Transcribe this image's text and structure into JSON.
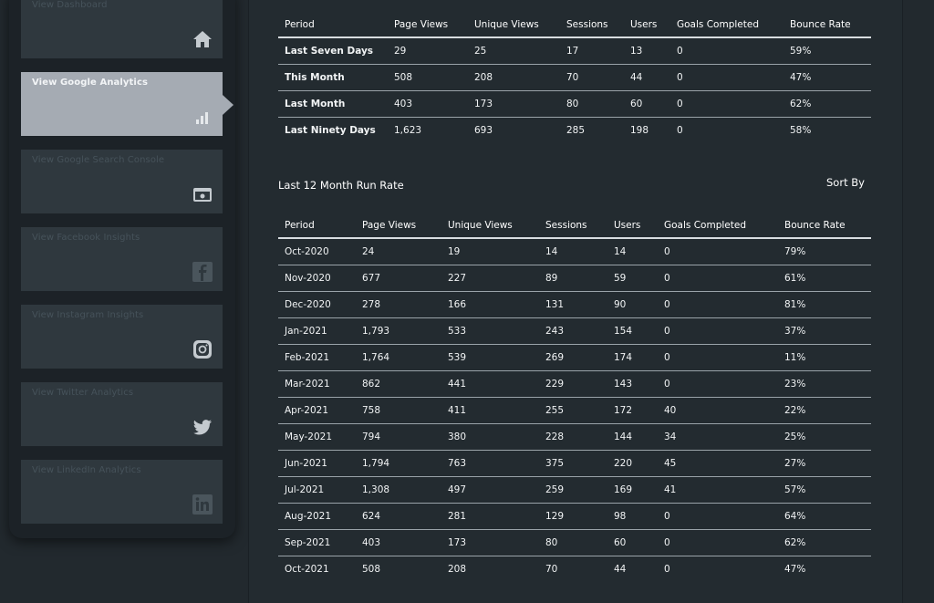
{
  "sidebar": {
    "items": [
      {
        "label": "View Dashboard",
        "icon": "home-icon",
        "active": false
      },
      {
        "label": "View Google Analytics",
        "icon": "analytics-icon",
        "active": true
      },
      {
        "label": "View Google Search Console",
        "icon": "search-console-icon",
        "active": false
      },
      {
        "label": "View Facebook Insights",
        "icon": "facebook-icon",
        "active": false
      },
      {
        "label": "View Instagram Insights",
        "icon": "instagram-icon",
        "active": false
      },
      {
        "label": "View Twitter Analytics",
        "icon": "twitter-icon",
        "active": false
      },
      {
        "label": "View LinkedIn Analytics",
        "icon": "linkedin-icon",
        "active": false
      }
    ]
  },
  "summary": {
    "headers": [
      "Period",
      "Page Views",
      "Unique Views",
      "Sessions",
      "Users",
      "Goals Completed",
      "Bounce Rate"
    ],
    "rows": [
      [
        "Last Seven Days",
        "29",
        "25",
        "17",
        "13",
        "0",
        "59%"
      ],
      [
        "This Month",
        "508",
        "208",
        "70",
        "44",
        "0",
        "47%"
      ],
      [
        "Last Month",
        "403",
        "173",
        "80",
        "60",
        "0",
        "62%"
      ],
      [
        "Last Ninety Days",
        "1,623",
        "693",
        "285",
        "198",
        "0",
        "58%"
      ]
    ]
  },
  "run_rate": {
    "title": "Last 12 Month Run Rate",
    "sort_label": "Sort By",
    "headers": [
      "Period",
      "Page Views",
      "Unique Views",
      "Sessions",
      "Users",
      "Goals Completed",
      "Bounce Rate"
    ],
    "rows": [
      [
        "Oct-2020",
        "24",
        "19",
        "14",
        "14",
        "0",
        "79%"
      ],
      [
        "Nov-2020",
        "677",
        "227",
        "89",
        "59",
        "0",
        "61%"
      ],
      [
        "Dec-2020",
        "278",
        "166",
        "131",
        "90",
        "0",
        "81%"
      ],
      [
        "Jan-2021",
        "1,793",
        "533",
        "243",
        "154",
        "0",
        "37%"
      ],
      [
        "Feb-2021",
        "1,764",
        "539",
        "269",
        "174",
        "0",
        "11%"
      ],
      [
        "Mar-2021",
        "862",
        "441",
        "229",
        "143",
        "0",
        "23%"
      ],
      [
        "Apr-2021",
        "758",
        "411",
        "255",
        "172",
        "40",
        "22%"
      ],
      [
        "May-2021",
        "794",
        "380",
        "228",
        "144",
        "34",
        "25%"
      ],
      [
        "Jun-2021",
        "1,794",
        "763",
        "375",
        "220",
        "45",
        "27%"
      ],
      [
        "Jul-2021",
        "1,308",
        "497",
        "259",
        "169",
        "41",
        "57%"
      ],
      [
        "Aug-2021",
        "624",
        "281",
        "129",
        "98",
        "0",
        "64%"
      ],
      [
        "Sep-2021",
        "403",
        "173",
        "80",
        "60",
        "0",
        "62%"
      ],
      [
        "Oct-2021",
        "508",
        "208",
        "70",
        "44",
        "0",
        "47%"
      ]
    ]
  },
  "colors": {
    "background": "#22292e",
    "card": "#2f383e",
    "active_card": "#a5abb3",
    "icon": "#c4cacf"
  }
}
